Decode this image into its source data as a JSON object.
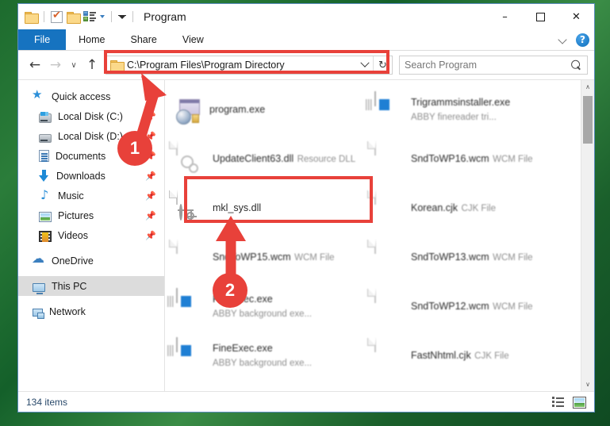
{
  "window": {
    "title": "Program",
    "quick_access": [
      {
        "name": "folder-icon",
        "label": "Folder"
      },
      {
        "name": "properties-icon",
        "label": "Properties"
      },
      {
        "name": "new-folder-icon",
        "label": "New folder"
      },
      {
        "name": "customize-icon",
        "label": "Customize Quick Access Toolbar"
      }
    ],
    "controls": {
      "minimize": "–",
      "maximize": "☐",
      "close": "✕"
    }
  },
  "ribbon": {
    "tabs": [
      {
        "label": "File",
        "active": true
      },
      {
        "label": "Home",
        "active": false
      },
      {
        "label": "Share",
        "active": false
      },
      {
        "label": "View",
        "active": false
      }
    ],
    "expand_label": "Expand the Ribbon",
    "help_label": "?"
  },
  "navigation": {
    "back": "←",
    "forward": "→",
    "recent": "∨",
    "up": "↑"
  },
  "address": {
    "path": "C:\\Program Files\\Program Directory",
    "dropdown": "∨",
    "refresh": "↻"
  },
  "search": {
    "placeholder": "Search Program",
    "value": ""
  },
  "sidebar": {
    "items": [
      {
        "label": "Quick access",
        "icon": "star-icon",
        "indent": false,
        "pinned": false,
        "selected": false,
        "gap_before": false
      },
      {
        "label": "Local Disk (C:)",
        "icon": "disk-c-icon",
        "indent": true,
        "pinned": true,
        "selected": false,
        "gap_before": false
      },
      {
        "label": "Local Disk (D:)",
        "icon": "disk-d-icon",
        "indent": true,
        "pinned": true,
        "selected": false,
        "gap_before": false
      },
      {
        "label": "Documents",
        "icon": "documents-icon",
        "indent": true,
        "pinned": true,
        "selected": false,
        "gap_before": false
      },
      {
        "label": "Downloads",
        "icon": "downloads-icon",
        "indent": true,
        "pinned": true,
        "selected": false,
        "gap_before": false
      },
      {
        "label": "Music",
        "icon": "music-icon",
        "indent": true,
        "pinned": true,
        "selected": false,
        "gap_before": false
      },
      {
        "label": "Pictures",
        "icon": "pictures-icon",
        "indent": true,
        "pinned": true,
        "selected": false,
        "gap_before": false
      },
      {
        "label": "Videos",
        "icon": "videos-icon",
        "indent": true,
        "pinned": true,
        "selected": false,
        "gap_before": false
      },
      {
        "label": "OneDrive",
        "icon": "onedrive-icon",
        "indent": false,
        "pinned": false,
        "selected": false,
        "gap_before": true
      },
      {
        "label": "This PC",
        "icon": "this-pc-icon",
        "indent": false,
        "pinned": false,
        "selected": true,
        "gap_before": true
      },
      {
        "label": "Network",
        "icon": "network-icon",
        "indent": false,
        "pinned": false,
        "selected": false,
        "gap_before": true
      }
    ]
  },
  "files": [
    {
      "name": "program.exe",
      "sub": "",
      "icon": "program-icon",
      "blur": "soft",
      "highlighted": false
    },
    {
      "name": "Trigrammsinstaller.exe",
      "sub": "ABBY finereader tri...",
      "icon": "app-icon",
      "blur": "soft",
      "highlighted": false
    },
    {
      "name": "UpdateClient63.dll",
      "sub": "Resource DLL",
      "icon": "dll-mag-icon",
      "blur": "soft",
      "highlighted": false
    },
    {
      "name": "SndToWP16.wcm",
      "sub": "WCM File",
      "icon": "blank-doc-icon",
      "blur": "soft",
      "highlighted": false
    },
    {
      "name": "mkl_sys.dll",
      "sub": "",
      "icon": "dll-gears-icon",
      "blur": "none",
      "highlighted": true
    },
    {
      "name": "Korean.cjk",
      "sub": "CJK File",
      "icon": "blank-doc-icon",
      "blur": "soft",
      "highlighted": false
    },
    {
      "name": "SndToWP15.wcm",
      "sub": "WCM File",
      "icon": "blank-doc-icon",
      "blur": "soft",
      "highlighted": false
    },
    {
      "name": "SndToWP13.wcm",
      "sub": "WCM File",
      "icon": "blank-doc-icon",
      "blur": "soft",
      "highlighted": false
    },
    {
      "name": "FineExec.exe",
      "sub": "ABBY background exe...",
      "icon": "app-icon",
      "blur": "soft",
      "highlighted": false
    },
    {
      "name": "SndToWP12.wcm",
      "sub": "WCM File",
      "icon": "blank-doc-icon",
      "blur": "soft",
      "highlighted": false
    },
    {
      "name": "FineExec.exe",
      "sub": "ABBY background exe...",
      "icon": "app-icon",
      "blur": "soft",
      "highlighted": false
    },
    {
      "name": "FastNhtml.cjk",
      "sub": "CJK File",
      "icon": "blank-doc-icon",
      "blur": "soft",
      "highlighted": false
    }
  ],
  "scrollbar": {
    "up": "∧",
    "down": "∨"
  },
  "statusbar": {
    "item_count": "134 items",
    "views": [
      {
        "name": "details-view-button",
        "label": "Details view"
      },
      {
        "name": "large-icons-view-button",
        "label": "Large icons view"
      }
    ]
  },
  "annotations": {
    "step1": "1",
    "step2": "2",
    "accent_color": "#e8413a"
  }
}
